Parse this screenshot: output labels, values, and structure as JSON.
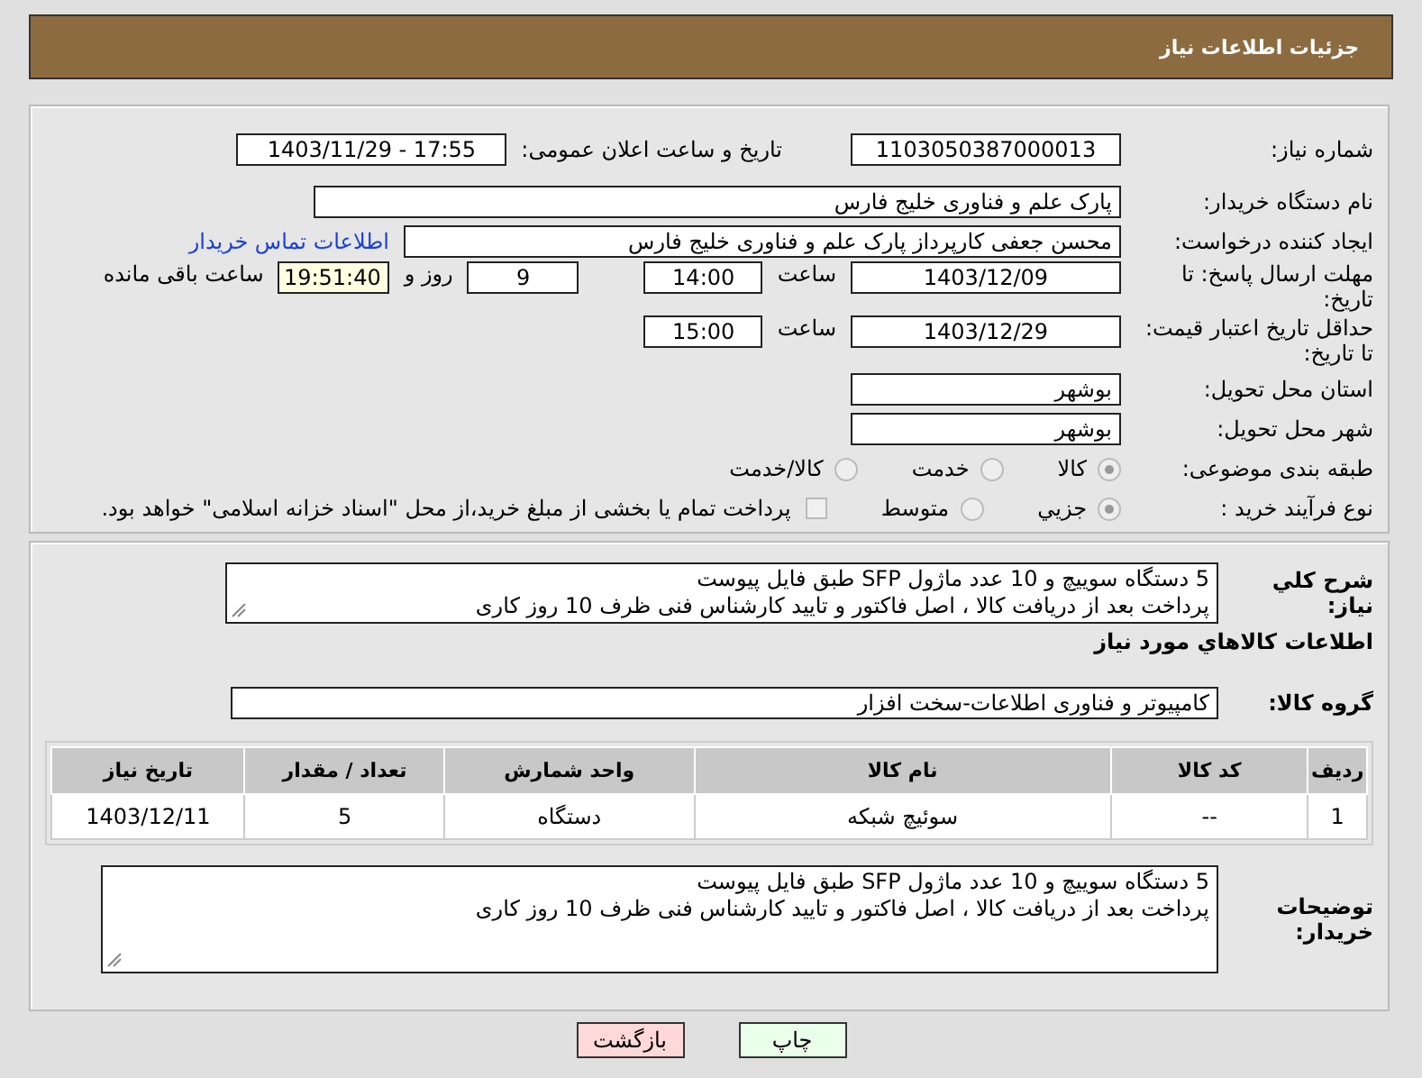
{
  "header": {
    "title": "جزئیات اطلاعات نیاز"
  },
  "details": {
    "need_number": {
      "label": "شماره نیاز:",
      "value": "1103050387000013"
    },
    "announce": {
      "label": "تاریخ و ساعت اعلان عمومی:",
      "value": "1403/11/29 - 17:55"
    },
    "buyer": {
      "label": "نام دستگاه خریدار:",
      "value": "پارک علم و فناوری خلیج فارس"
    },
    "creator": {
      "label": "ایجاد کننده درخواست:",
      "value": "محسن جعفی کارپرداز پارک علم و فناوری خلیج فارس",
      "link": "اطلاعات تماس خریدار"
    },
    "deadline": {
      "label": "مهلت ارسال پاسخ: تا تاریخ:",
      "date": "1403/12/09",
      "time_label": "ساعت",
      "time": "14:00",
      "days": "9",
      "days_label": "روز و",
      "remaining": "19:51:40",
      "remaining_label": "ساعت باقی مانده"
    },
    "validity": {
      "label": "حداقل تاریخ اعتبار قیمت: تا تاریخ:",
      "date": "1403/12/29",
      "time_label": "ساعت",
      "time": "15:00"
    },
    "province": {
      "label": "استان محل تحویل:",
      "value": "بوشهر"
    },
    "city": {
      "label": "شهر محل تحویل:",
      "value": "بوشهر"
    },
    "category": {
      "label": "طبقه بندی موضوعی:",
      "options": [
        {
          "label": "کالا",
          "selected": true
        },
        {
          "label": "خدمت",
          "selected": false
        },
        {
          "label": "کالا/خدمت",
          "selected": false
        }
      ]
    },
    "purchase": {
      "label": "نوع فرآیند خرید :",
      "options": [
        {
          "label": "جزیي",
          "selected": true
        },
        {
          "label": "متوسط",
          "selected": false
        }
      ],
      "payment": {
        "label": "پرداخت تمام یا بخشی از مبلغ خرید،از محل \"اسناد خزانه اسلامی\" خواهد بود.",
        "checked": false
      }
    }
  },
  "goods": {
    "description": {
      "label": "شرح کلي نیاز:",
      "lines": [
        "5 دستگاه سوییچ و 10 عدد ماژول SFP طبق فایل پیوست",
        "پرداخت بعد از دریافت کالا ، اصل فاکتور و تایید کارشناس فنی ظرف 10 روز کاری"
      ]
    },
    "heading": "اطلاعات کالاهاي مورد نیاز",
    "group": {
      "label": "گروه کالا:",
      "value": "کامپیوتر و فناوری اطلاعات-سخت افزار"
    },
    "table": {
      "columns": [
        "ردیف",
        "کد کالا",
        "نام کالا",
        "واحد شمارش",
        "تعداد / مقدار",
        "تاریخ نیاز"
      ],
      "rows": [
        [
          "1",
          "--",
          "سوئیچ شبکه",
          "دستگاه",
          "5",
          "1403/12/11"
        ]
      ]
    },
    "notes": {
      "label": "توضیحات خریدار:",
      "lines": [
        "5 دستگاه سوییچ و 10 عدد ماژول SFP طبق فایل پیوست",
        "پرداخت بعد از دریافت کالا ، اصل فاکتور و تایید کارشناس فنی ظرف 10 روز کاری"
      ]
    }
  },
  "buttons": [
    {
      "kind": "print",
      "label": "چاپ"
    },
    {
      "kind": "back",
      "label": "بازگشت"
    }
  ]
}
